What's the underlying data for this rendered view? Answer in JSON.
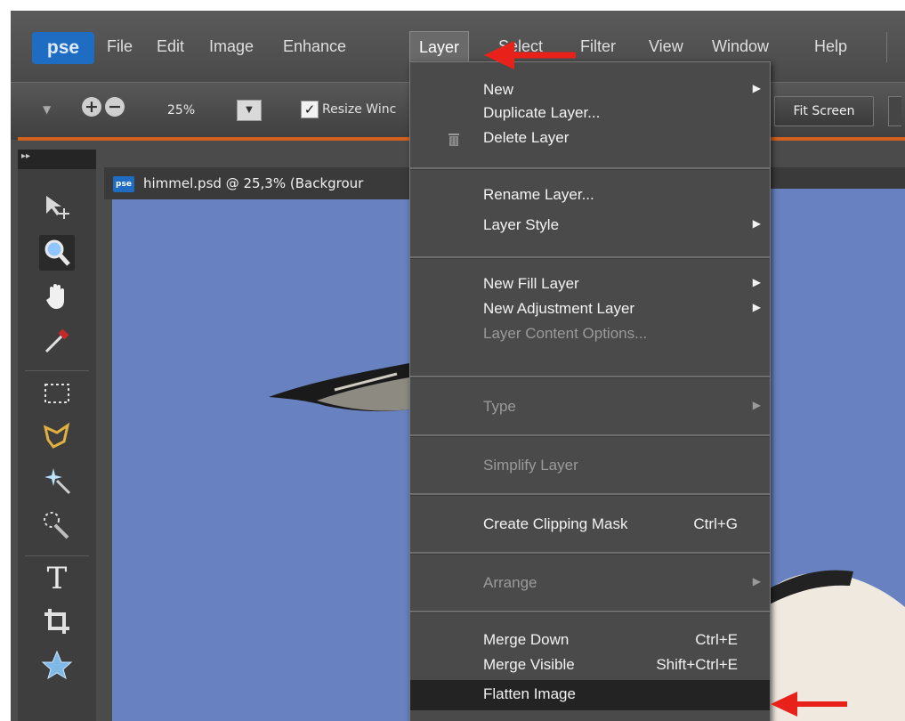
{
  "app": {
    "logo": "pse",
    "menu": [
      "File",
      "Edit",
      "Image",
      "Enhance",
      "Layer",
      "Select",
      "Filter",
      "View",
      "Window",
      "Help"
    ],
    "active_menu": "Layer"
  },
  "options": {
    "zoom_value": "25%",
    "resize_label": "Resize Winc",
    "fit_screen": "Fit Screen",
    "resize_checked": true
  },
  "document": {
    "title": "himmel.psd @ 25,3% (Backgrour",
    "icon_label": "pse"
  },
  "layer_menu": {
    "new": "New",
    "duplicate": "Duplicate Layer...",
    "delete": "Delete Layer",
    "rename": "Rename Layer...",
    "style": "Layer Style",
    "new_fill": "New Fill Layer",
    "new_adjustment": "New Adjustment Layer",
    "content_options": "Layer Content Options...",
    "type": "Type",
    "simplify": "Simplify Layer",
    "clipping": "Create Clipping Mask",
    "clipping_sc": "Ctrl+G",
    "arrange": "Arrange",
    "merge_down": "Merge Down",
    "merge_down_sc": "Ctrl+E",
    "merge_visible": "Merge Visible",
    "merge_visible_sc": "Shift+Ctrl+E",
    "flatten": "Flatten Image"
  },
  "toolbox_icons": [
    "move-tool-icon",
    "zoom-tool-icon",
    "hand-tool-icon",
    "eyedropper-tool-icon",
    "marquee-tool-icon",
    "lasso-tool-icon",
    "magic-wand-tool-icon",
    "quick-selection-tool-icon",
    "type-tool-icon",
    "crop-tool-icon",
    "shape-tool-icon"
  ],
  "colors": {
    "accent_orange": "#d3611e",
    "logo_blue": "#1e6dc2",
    "sky_blue": "#6882c1",
    "annotation_red": "#e8211b"
  }
}
